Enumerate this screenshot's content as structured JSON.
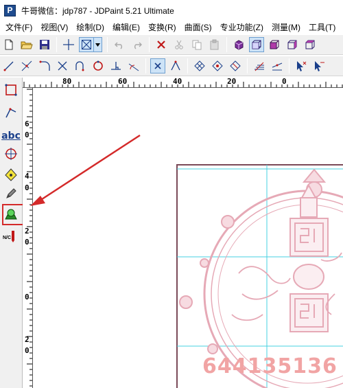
{
  "window": {
    "title": "牛哥微信：jdp787    - JDPaint 5.21 Ultimate",
    "app_icon_letter": "P"
  },
  "menu": {
    "items": [
      "文件(F)",
      "视图(V)",
      "绘制(D)",
      "编辑(E)",
      "变换(R)",
      "曲面(S)",
      "专业功能(Z)",
      "测量(M)",
      "工具(T)"
    ]
  },
  "toolbar1": {
    "icons": [
      "new-file-icon",
      "open-folder-icon",
      "save-icon",
      "crosshair-icon",
      "select-box-icon",
      "undo-icon",
      "redo-icon",
      "delete-icon",
      "cut-icon",
      "copy-icon",
      "paste-icon",
      "shaded-cube-icon",
      "wireframe-cube-icon",
      "front-cube-icon",
      "side-cube-icon",
      "iso-cube-icon"
    ]
  },
  "toolbar2": {
    "icons": [
      "line-node-icon",
      "trim-icon",
      "fillet-icon",
      "cross-icon",
      "arc-node-icon",
      "circle-node-icon",
      "perpendicular-icon",
      "tangent-icon",
      "center-snap-icon",
      "intersection-icon",
      "grid-diamond-icon",
      "grid-diamond-2-icon",
      "grid-diamond-3-icon",
      "layer-icon",
      "layer-2-icon",
      "pick-arrow-icon",
      "pick-arrow-2-icon"
    ]
  },
  "left_toolbar": {
    "icons": [
      "select-rect-icon",
      "draw-curve-icon",
      "text-abc-icon",
      "transform-circle-icon",
      "measure-icon",
      "pen-icon",
      "relief-surface-icon",
      "nc-toolpath-icon"
    ],
    "text_icon_label": "abc",
    "nc_label": "N/C"
  },
  "ruler_top": {
    "labels": [
      "80",
      "60",
      "40",
      "20",
      "0"
    ]
  },
  "ruler_left": {
    "labels": [
      "6",
      "0",
      "4",
      "0",
      "2",
      "0",
      "0",
      "2",
      "0"
    ]
  },
  "watermark": "644135136",
  "colors": {
    "highlight_red": "#d42a2a",
    "grid_cyan": "#44d0e0",
    "relief_pink": "#e6a9b6",
    "frame_dark": "#7a4a58"
  }
}
